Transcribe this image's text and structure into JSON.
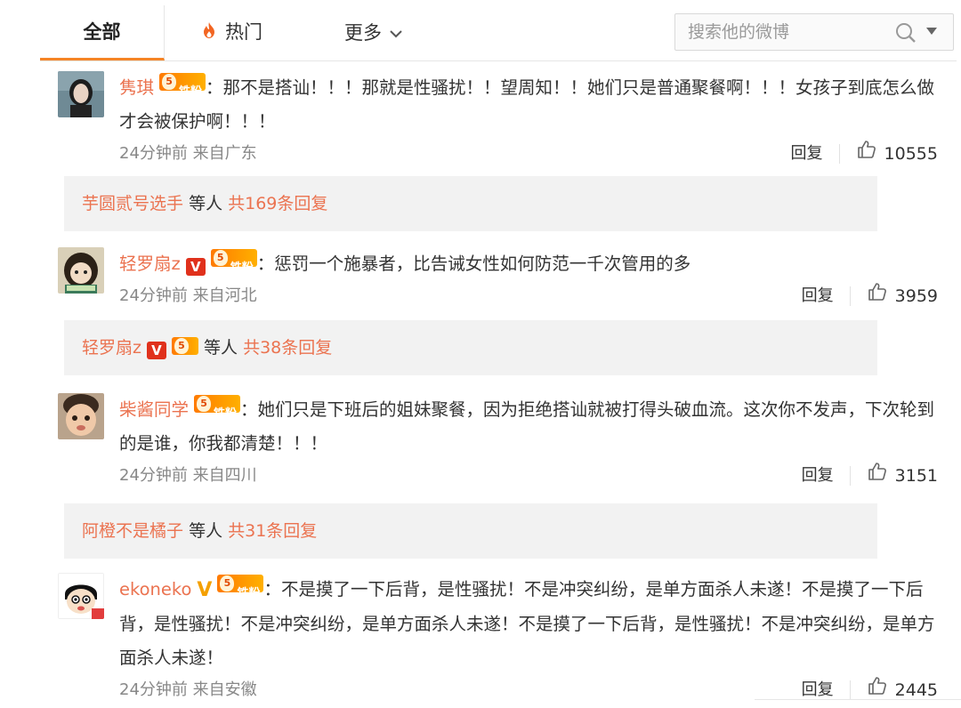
{
  "tabs": {
    "all_label": "全部",
    "hot_label": "热门",
    "more_label": "更多"
  },
  "search": {
    "placeholder": "搜索他的微博"
  },
  "colors": {
    "accent": "#f58426",
    "username": "#eb7350",
    "verified_red": "#e0311c",
    "verified_yellow": "#f4a000"
  },
  "comments": [
    {
      "username": "隽琪",
      "fan_badge": "铁粉",
      "fan_level": "5",
      "text": "：那不是搭讪！！！那就是性骚扰！！望周知！！她们只是普通聚餐啊！！！女孩子到底怎么做才会被保护啊！！！",
      "time": "24分钟前 来自广东",
      "reply_label": "回复",
      "likes": "10555",
      "reply_summary": {
        "names": "芋圆贰号选手",
        "middle": "等人",
        "count_text": "共169条回复"
      }
    },
    {
      "username": "轻罗扇z",
      "verified": "V",
      "fan_badge": "铁粉",
      "fan_level": "5",
      "text": "：惩罚一个施暴者，比告诫女性如何防范一千次管用的多",
      "time": "24分钟前 来自河北",
      "reply_label": "回复",
      "likes": "3959",
      "reply_summary": {
        "names": "轻罗扇z",
        "verified": "V",
        "middle": "等人",
        "count_text": "共38条回复"
      }
    },
    {
      "username": "柴酱同学",
      "fan_badge": "铁粉",
      "fan_level": "5",
      "text": "：她们只是下班后的姐妹聚餐，因为拒绝搭讪就被打得头破血流。这次你不发声，下次轮到的是谁，你我都清楚！！！",
      "time": "24分钟前 来自四川",
      "reply_label": "回复",
      "likes": "3151",
      "reply_summary": {
        "names": "阿橙不是橘子",
        "middle": "等人",
        "count_text": "共31条回复"
      }
    },
    {
      "username": "ekoneko",
      "verified": "V",
      "fan_badge": "铁粉",
      "fan_level": "5",
      "text": "：不是摸了一下后背，是性骚扰！不是冲突纠纷，是单方面杀人未遂！不是摸了一下后背，是性骚扰！不是冲突纠纷，是单方面杀人未遂！不是摸了一下后背，是性骚扰！不是冲突纠纷，是单方面杀人未遂！",
      "time": "24分钟前 来自安徽",
      "reply_label": "回复",
      "likes": "2445"
    }
  ]
}
